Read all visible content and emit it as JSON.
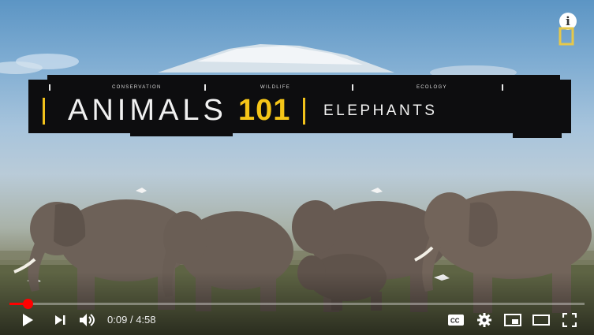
{
  "video": {
    "categories": [
      "CONSERVATION",
      "WILDLIFE",
      "ECOLOGY"
    ],
    "title_main": "ANIMALS",
    "title_number": "101",
    "title_sub": "ELEPHANTS",
    "progress": 0.032,
    "info_label": "i"
  },
  "controls": {
    "time_current": "0:09",
    "time_separator": "/",
    "time_total": "4:58",
    "icons": [
      "play-icon",
      "next-icon",
      "volume-icon",
      "captions-icon",
      "settings-icon",
      "miniplayer-icon",
      "theater-icon",
      "fullscreen-icon"
    ]
  },
  "colors": {
    "progress": "#ff0000",
    "accent": "#f5c518",
    "banner": "#0d0d0f"
  }
}
